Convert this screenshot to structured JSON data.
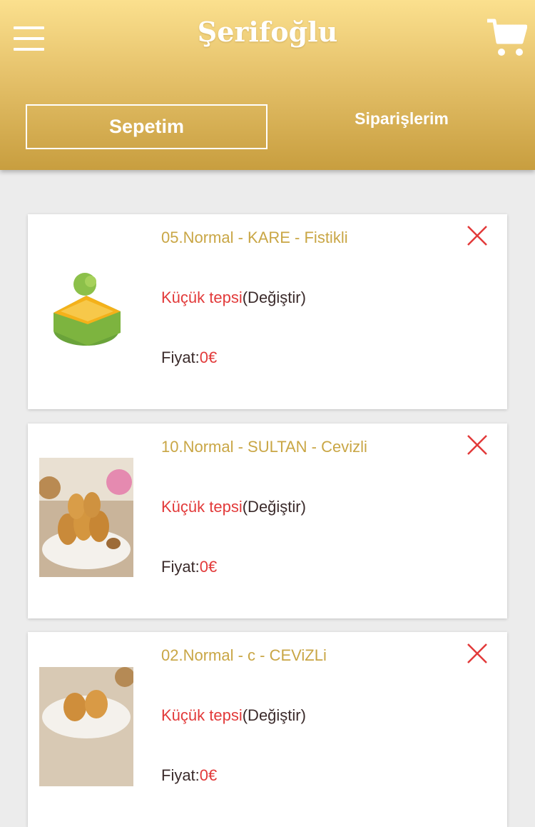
{
  "header": {
    "brand": "Şerifoğlu",
    "menu_icon": "hamburger-menu-icon",
    "cart_icon": "shopping-cart-icon",
    "colors": {
      "gradient_top": "#fbe08e",
      "gradient_bottom": "#c89e3f"
    }
  },
  "tabs": [
    {
      "label": "Sepetim",
      "active": true
    },
    {
      "label": "Siparişlerim",
      "active": false
    }
  ],
  "cart_items": [
    {
      "title": "05.Normal - KARE - Fistikli",
      "size": "Küçük tepsi",
      "change_label": "(Değiştir)",
      "price_label": "Fiyat:",
      "price_value": "0€",
      "image": "kare-fistikli-baklava"
    },
    {
      "title": "10.Normal - SULTAN - Cevizli",
      "size": "Küçük tepsi",
      "change_label": "(Değiştir)",
      "price_label": "Fiyat:",
      "price_value": "0€",
      "image": "sultan-cevizli-baklava"
    },
    {
      "title": "02.Normal - c - CEViZLi",
      "size": "Küçük tepsi",
      "change_label": "(Değiştir)",
      "price_label": "Fiyat:",
      "price_value": "0€",
      "image": "cevizli-baklava"
    }
  ],
  "colors": {
    "accent_gold": "#c9a645",
    "accent_red": "#e23a3a",
    "text_dark": "#3b2b2b",
    "background": "#ececec"
  }
}
